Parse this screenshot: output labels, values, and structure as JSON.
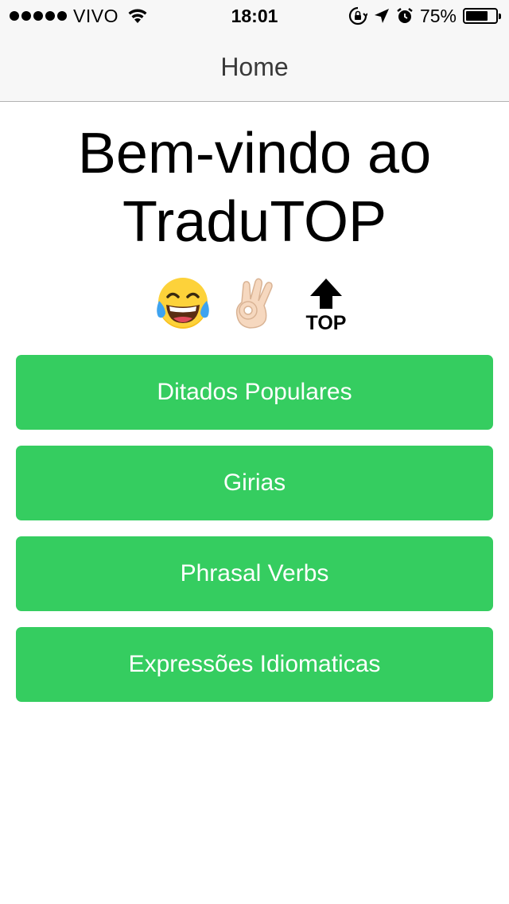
{
  "status_bar": {
    "carrier": "VIVO",
    "time": "18:01",
    "battery_percent": "75%",
    "battery_level": 0.75,
    "icons": [
      "signal-dots-icon",
      "wifi-icon",
      "orientation-lock-icon",
      "location-icon",
      "alarm-icon",
      "battery-icon"
    ]
  },
  "nav": {
    "title": "Home"
  },
  "main": {
    "welcome_line1": "Bem-vindo ao",
    "welcome_line2": "TraduTOP",
    "emojis": [
      "tears-of-joy-emoji",
      "ok-hand-emoji",
      "top-arrow-emoji"
    ],
    "top_label": "TOP"
  },
  "buttons": [
    {
      "label": "Ditados Populares"
    },
    {
      "label": "Girias"
    },
    {
      "label": "Phrasal Verbs"
    },
    {
      "label": "Expressões Idiomaticas"
    }
  ],
  "colors": {
    "button_green": "#35cd60",
    "bar_background": "#f7f7f7",
    "nav_title": "#3a3a3a"
  }
}
